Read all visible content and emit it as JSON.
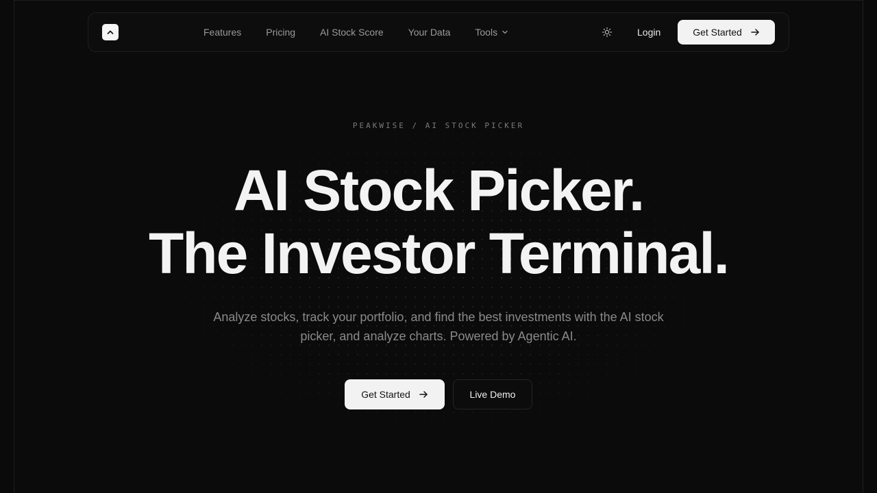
{
  "nav": {
    "logo_icon": "chevron-up-icon",
    "links": [
      {
        "label": "Features"
      },
      {
        "label": "Pricing"
      },
      {
        "label": "AI Stock Score"
      },
      {
        "label": "Your Data"
      },
      {
        "label": "Tools"
      }
    ],
    "theme_icon": "sun-icon",
    "login_label": "Login",
    "cta_label": "Get Started"
  },
  "hero": {
    "eyebrow": "PEAKWISE / AI STOCK PICKER",
    "headline_line1": "AI Stock Picker.",
    "headline_line2": "The Investor Terminal.",
    "subtitle": "Analyze stocks, track your portfolio, and find the best investments with the AI stock picker, and analyze charts. Powered by Agentic AI.",
    "primary_cta": "Get Started",
    "secondary_cta": "Live Demo"
  },
  "colors": {
    "background": "#0a0a0a",
    "button_light": "#f2f2f2",
    "muted_text": "#8a8a8a"
  }
}
